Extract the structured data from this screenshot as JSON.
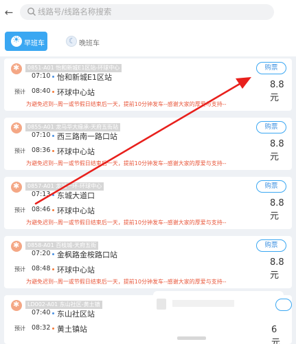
{
  "search": {
    "placeholder": "线路号/线路名称搜索"
  },
  "tabs": [
    {
      "label": "早班车",
      "icon": "sun-icon",
      "active": true
    },
    {
      "label": "晚班车",
      "icon": "moon-icon",
      "active": false
    }
  ],
  "depart_prefix": "预计",
  "buy_label": "购票",
  "cards": [
    {
      "route": "0851-A01 怡和新城E1区站-环球中心",
      "depart_time": "07:10",
      "arrive_time": "08:40",
      "from": "怡和新城E1区站",
      "to": "环球中心站",
      "price": "8.8元",
      "notice": "为避免迟到--周一或节假日结束后一天，提前10分钟发车--感谢大家的厚爱与支持--"
    },
    {
      "route": "0855-A01 龙马华大缘承-天府五街站",
      "depart_time": "07:10",
      "arrive_time": "08:36",
      "from": "西三路南一路口站",
      "to": "环球中心站",
      "price": "8.8元",
      "notice": "为避免迟到--周一或节假日结束后一天，提前10分钟发车--感谢大家的厚爱与支持--"
    },
    {
      "route": "0857-A01 龙城一环-环球中心",
      "depart_time": "07:13",
      "arrive_time": "08:46",
      "from": "东城大道口",
      "to": "环球中心站",
      "price": "8.8元",
      "notice": "为避免迟到--周一或节假日结束后一天，提前10分钟发车--感谢大家的厚爱与支持--"
    },
    {
      "route": "0858-A01 百枝城-天府五街",
      "depart_time": "07:20",
      "arrive_time": "08:48",
      "from": "金枫路金桉路口站",
      "to": "环球中心站",
      "price": "8.8元",
      "notice": "为避免迟到--周一或节假日结束后一天，提前10分钟发车--感谢大家的厚爱与支持--"
    },
    {
      "route": "LD002-A01 东山社区-黄土镇",
      "depart_time": "07:40",
      "arrive_time": "08:32",
      "from": "东山社区站",
      "to": "黄土镇站",
      "price": "",
      "notice": ""
    }
  ],
  "popup": {
    "price": "6元"
  },
  "colors": {
    "accent": "#3aa7f2",
    "notice": "#e8563a",
    "annotation_arrow": "#e8201c"
  }
}
